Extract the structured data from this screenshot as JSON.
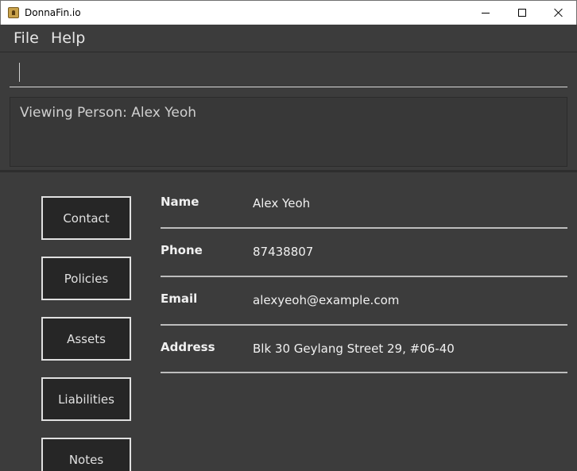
{
  "window": {
    "title": "DonnaFin.io",
    "icon": "app-logo-icon",
    "controls": [
      "minimize-icon",
      "maximize-icon",
      "close-icon"
    ]
  },
  "menu": {
    "file": "File",
    "help": "Help"
  },
  "command": {
    "value": "",
    "placeholder": ""
  },
  "result": {
    "message": "Viewing Person: Alex Yeoh"
  },
  "tabs": [
    {
      "label": "Contact"
    },
    {
      "label": "Policies"
    },
    {
      "label": "Assets"
    },
    {
      "label": "Liabilities"
    },
    {
      "label": "Notes"
    }
  ],
  "details": [
    {
      "label": "Name",
      "value": "Alex Yeoh"
    },
    {
      "label": "Phone",
      "value": "87438807"
    },
    {
      "label": "Email",
      "value": "alexyeoh@example.com"
    },
    {
      "label": "Address",
      "value": "Blk 30 Geylang Street 29, #06-40"
    }
  ],
  "colors": {
    "background": "#3c3c3c",
    "button_bg": "#262626",
    "button_border": "#e0e0e0",
    "text": "#f0f0f0"
  }
}
